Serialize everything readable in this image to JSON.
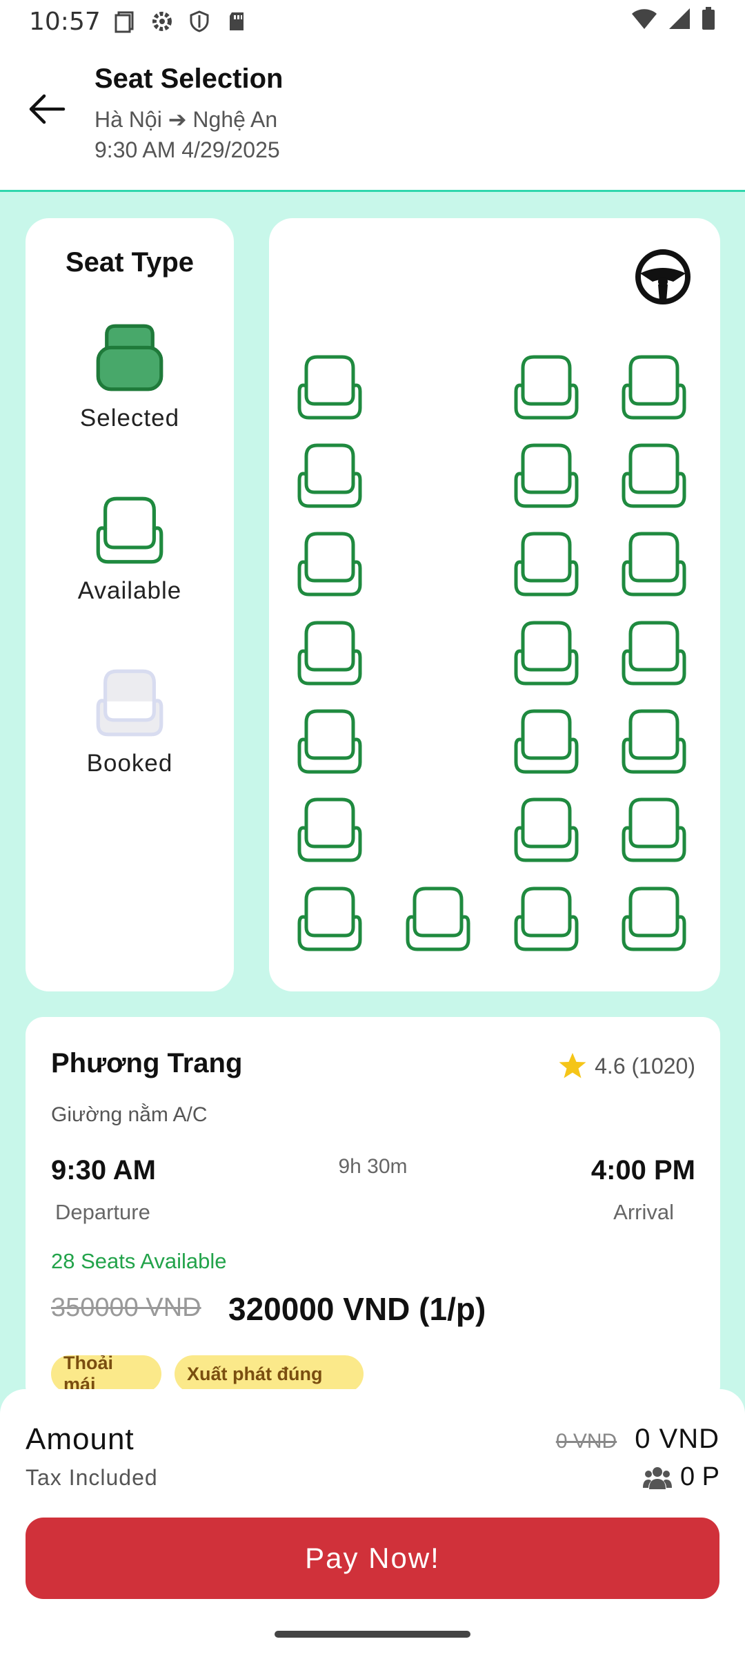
{
  "status_bar": {
    "time": "10:57",
    "left_icons": [
      "screen-icon",
      "settings-icon",
      "shield-icon",
      "sd-card-icon"
    ],
    "right_icons": [
      "wifi-icon",
      "signal-icon",
      "battery-icon"
    ]
  },
  "header": {
    "title": "Seat Selection",
    "route": "Hà Nội ➔ Nghệ An",
    "datetime": "9:30 AM 4/29/2025"
  },
  "legend": {
    "title": "Seat Type",
    "items": [
      {
        "label": "Selected",
        "state": "selected"
      },
      {
        "label": "Available",
        "state": "available"
      },
      {
        "label": "Booked",
        "state": "booked"
      }
    ]
  },
  "seat_map": {
    "layout": "3 rows of seats in the upper section: left column and two right columns, plus a full back row of 4",
    "seats_left_column": 7,
    "seats_right_columns": 14,
    "back_row_center_seats": 1,
    "seat_state": "available"
  },
  "trip": {
    "operator": "Phương Trang",
    "rating": "4.6 (1020)",
    "bus_type": "Giường nằm A/C",
    "departure_time": "9:30 AM",
    "duration": "9h 30m",
    "arrival_time": "4:00 PM",
    "departure_label": "Departure",
    "arrival_label": "Arrival",
    "seats_available": "28 Seats Available",
    "old_price": "350000 VND",
    "new_price": "320000 VND (1/p)",
    "tags": [
      "Thoải mái",
      "Xuất phát đúng"
    ]
  },
  "payment": {
    "amount_label": "Amount",
    "tax_label": "Tax Included",
    "old_total": "0 VND",
    "total": "0 VND",
    "passengers": "0 P",
    "pay_button": "Pay Now!"
  },
  "colors": {
    "accent_bg": "#c8f7ea",
    "seat_green": "#1f8a3f",
    "selected_fill": "#48a86a",
    "booked_fill": "#ececf0",
    "pay_button": "#d0313a",
    "tag_bg": "#fbe98a"
  }
}
